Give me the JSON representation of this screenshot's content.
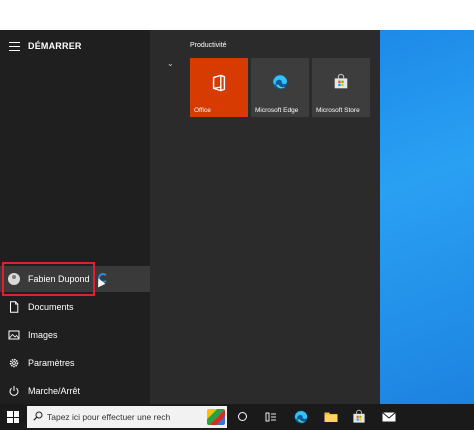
{
  "start_menu": {
    "title": "DÉMARRER",
    "user": {
      "name": "Fabien Dupond"
    },
    "rail_items": [
      {
        "label": "Documents",
        "icon": "document-icon"
      },
      {
        "label": "Images",
        "icon": "image-icon"
      },
      {
        "label": "Paramètres",
        "icon": "gear-icon"
      },
      {
        "label": "Marche/Arrêt",
        "icon": "power-icon"
      }
    ],
    "tile_group": {
      "title": "Productivité",
      "tiles": [
        {
          "label": "Office",
          "icon": "office-icon",
          "color": "#d83b01"
        },
        {
          "label": "Microsoft Edge",
          "icon": "edge-icon",
          "color": "#3d3d3d"
        },
        {
          "label": "Microsoft Store",
          "icon": "store-icon",
          "color": "#3d3d3d"
        }
      ]
    }
  },
  "taskbar": {
    "search_placeholder": "Tapez ici pour effectuer une rech",
    "pinned": [
      "cortana-icon",
      "task-view-icon",
      "edge-icon",
      "file-explorer-icon",
      "store-icon",
      "mail-icon"
    ]
  },
  "colors": {
    "highlight": "#e0202a",
    "office": "#d83b01",
    "accent": "#0078d7"
  }
}
